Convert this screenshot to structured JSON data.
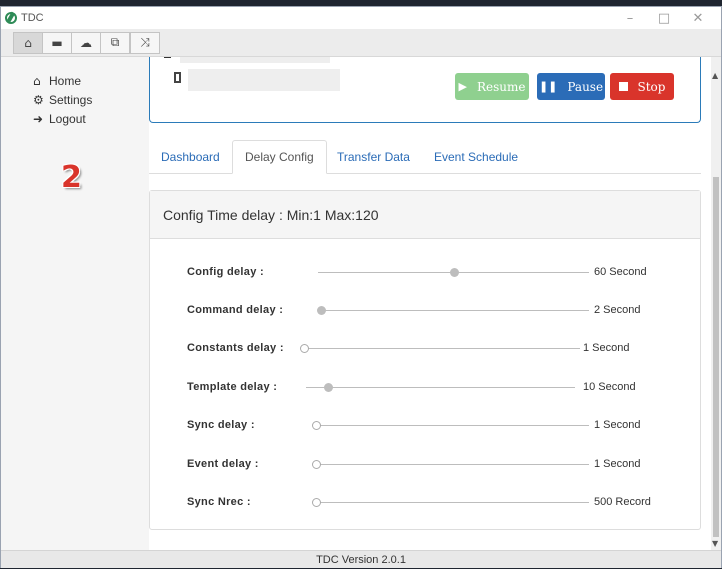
{
  "window": {
    "title": "TDC",
    "minimize": "–",
    "maximize": "□",
    "close": "✕"
  },
  "toolbar": {
    "icons": [
      "home-icon",
      "folder-icon",
      "cloud-icon",
      "copy-icon",
      "shuffle-icon"
    ]
  },
  "sidebar": {
    "items": [
      {
        "label": "Home",
        "icon": "home-icon"
      },
      {
        "label": "Settings",
        "icon": "gear-icon"
      },
      {
        "label": "Logout",
        "icon": "logout-icon"
      }
    ],
    "badge_number": "2"
  },
  "status": {
    "controls": {
      "resume": "Resume",
      "pause": "Pause",
      "stop": "Stop"
    },
    "colors": {
      "resume": "#8fd08f",
      "pause": "#2b6cb7",
      "stop": "#d9342b"
    }
  },
  "tabs": [
    "Dashboard",
    "Delay Config",
    "Transfer Data",
    "Event Schedule"
  ],
  "active_tab": "Delay Config",
  "panel": {
    "title": "Config Time delay : Min:1 Max:120",
    "rows": [
      {
        "label": "Config delay :",
        "value": "60 Second",
        "level": 0.5
      },
      {
        "label": "Command delay :",
        "value": "2 Second",
        "level": 0.01
      },
      {
        "label": "Constants delay :",
        "value": "1 Second",
        "level": 0
      },
      {
        "label": "Template delay :",
        "value": "10 Second",
        "level": 0.08
      },
      {
        "label": "Sync delay :",
        "value": "1 Second",
        "level": 0
      },
      {
        "label": "Event delay :",
        "value": "1 Second",
        "level": 0
      },
      {
        "label": "Sync Nrec :",
        "value": "500 Record",
        "level": 0
      }
    ]
  },
  "footer": {
    "version": "TDC Version 2.0.1"
  }
}
